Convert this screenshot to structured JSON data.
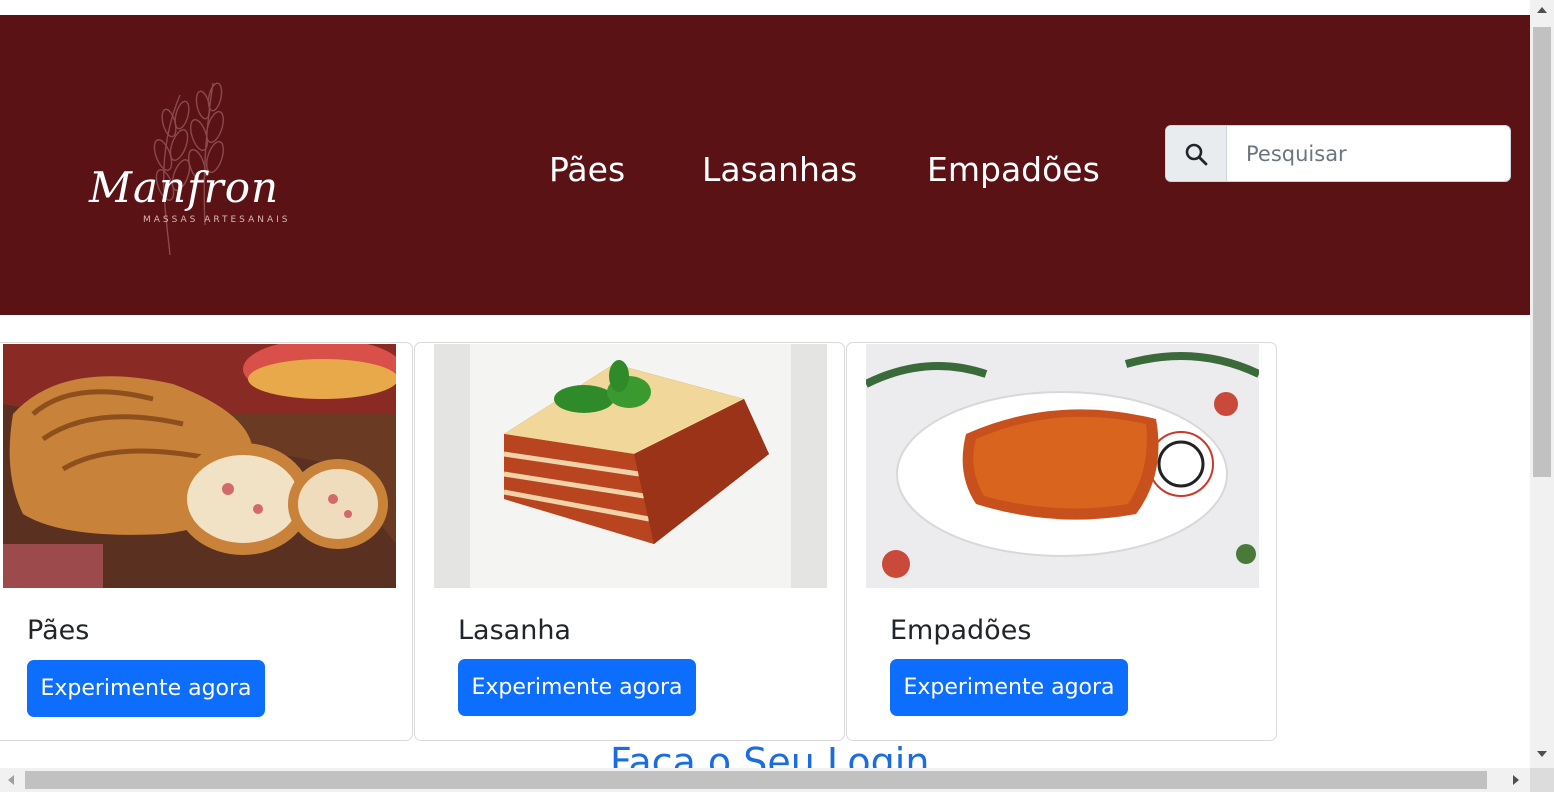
{
  "brand": {
    "name": "Manfron",
    "tagline": "MASSAS ARTESANAIS",
    "header_color": "#5a1215"
  },
  "nav": {
    "items": [
      {
        "label": "Pães"
      },
      {
        "label": "Lasanhas"
      },
      {
        "label": "Empadões"
      }
    ]
  },
  "search": {
    "icon": "search-icon",
    "placeholder": "Pesquisar",
    "value": ""
  },
  "cards": [
    {
      "title": "Pães",
      "button": "Experimente agora",
      "image": "bread-photo"
    },
    {
      "title": "Lasanha",
      "button": "Experimente agora",
      "image": "lasagna-photo"
    },
    {
      "title": "Empadões",
      "button": "Experimente agora",
      "image": "pie-photo"
    }
  ],
  "login": {
    "title": "Faça o Seu Login"
  },
  "colors": {
    "primary_button": "#0d6efd",
    "link_heading": "#1b6ddf"
  }
}
